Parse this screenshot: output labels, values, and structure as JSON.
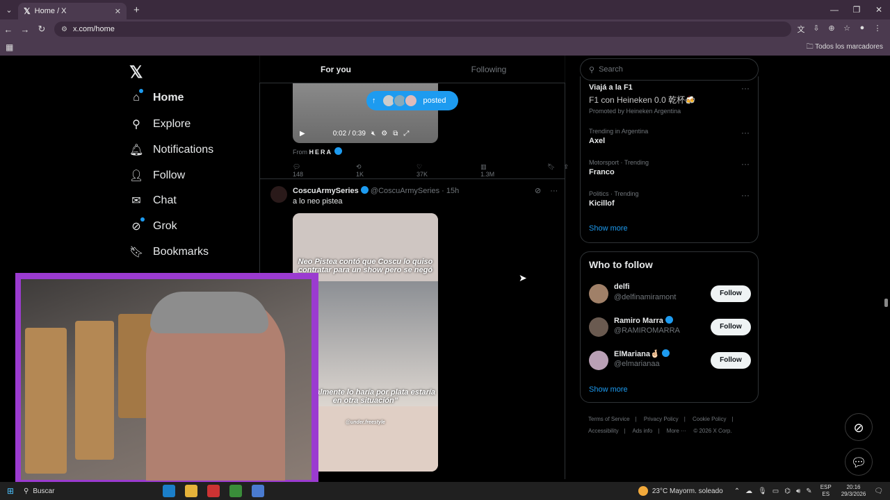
{
  "browser": {
    "tab_title": "Home / X",
    "tab_logo": "𝕏",
    "url": "x.com/home",
    "bookmarks_all": "Todos los marcadores"
  },
  "nav": {
    "logo": "𝕏",
    "items": [
      {
        "label": "Home",
        "icon": "home-icon"
      },
      {
        "label": "Explore",
        "icon": "search-icon"
      },
      {
        "label": "Notifications",
        "icon": "bell-icon"
      },
      {
        "label": "Follow",
        "icon": "follow-icon"
      },
      {
        "label": "Chat",
        "icon": "mail-icon"
      },
      {
        "label": "Grok",
        "icon": "grok-icon"
      },
      {
        "label": "Bookmarks",
        "icon": "bookmark-icon"
      }
    ]
  },
  "feed": {
    "tabs": [
      "For you",
      "Following"
    ],
    "posted_pill": "posted",
    "video_time": "0:02 / 0:39",
    "from_label": "From",
    "from_brand": "HERA",
    "post1_actions": {
      "replies": "148",
      "reposts": "1K",
      "likes": "37K",
      "views": "1.3M"
    },
    "post2": {
      "name": "CoscuArmySeries",
      "handle": "@CoscuArmySeries",
      "time": "· 15h",
      "text": "a lo neo pistea",
      "caption_top": "Neo Pistea contó que Coscu lo quiso contratar para un show pero se negó",
      "caption_bottom": "“Si realmente lo haría por plata estaría en otra situación”",
      "watermark": "@under.freestyle"
    }
  },
  "right": {
    "search_placeholder": "Search",
    "promo": {
      "title": "Viajá a la F1",
      "sub": "F1 con Heineken 0.0 乾杯🍻",
      "promoted": "Promoted by Heineken Argentina"
    },
    "trends": [
      {
        "meta": "Trending in Argentina",
        "name": "Axel"
      },
      {
        "meta": "Motorsport · Trending",
        "name": "Franco"
      },
      {
        "meta": "Politics · Trending",
        "name": "Kicillof"
      }
    ],
    "show_more": "Show more",
    "wtf_title": "Who to follow",
    "wtf": [
      {
        "name": "delfi",
        "handle": "@delfinamiramont",
        "verified": false
      },
      {
        "name": "Ramiro Marra",
        "handle": "@RAMIROMARRA",
        "verified": true
      },
      {
        "name": "ElMariana🤞🏻",
        "handle": "@elmarianaa",
        "verified": true
      }
    ],
    "follow_label": "Follow",
    "footer": [
      "Terms of Service",
      "|",
      "Privacy Policy",
      "|",
      "Cookie Policy",
      "|",
      "Accessibility",
      "|",
      "Ads info",
      "|",
      "More ···",
      "© 2026 X Corp."
    ]
  },
  "taskbar": {
    "search": "Buscar",
    "weather": "23°C  Mayorm. soleado",
    "lang1": "ESP",
    "lang2": "ES",
    "time": "20:16",
    "date": "29/3/2026"
  }
}
